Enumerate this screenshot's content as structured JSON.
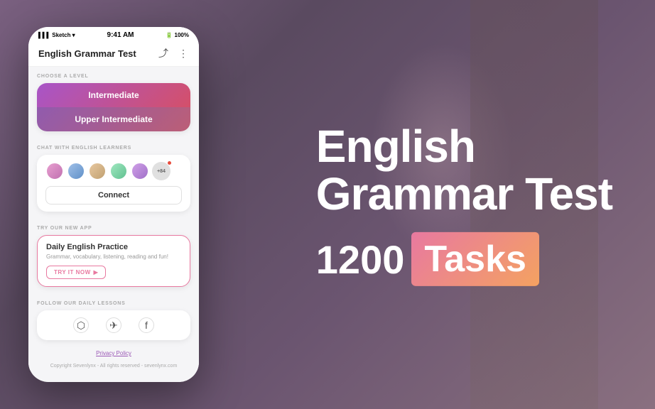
{
  "background": {
    "color": "#6b5a6e"
  },
  "phone": {
    "status_bar": {
      "carrier": "Sketch",
      "signal": "▌▌▌",
      "wifi": "▾",
      "time": "9:41 AM",
      "battery": "100%"
    },
    "header": {
      "title": "English Grammar Test",
      "share_icon": "share",
      "menu_icon": "more"
    },
    "choose_level": {
      "label": "CHOOSE A LEVEL",
      "buttons": [
        {
          "text": "Intermediate",
          "active": true
        },
        {
          "text": "Upper Intermediate",
          "active": false
        }
      ]
    },
    "chat_section": {
      "label": "CHAT WITH ENGLISH LEARNERS",
      "count_label": "+84",
      "connect_label": "Connect"
    },
    "new_app_section": {
      "label": "TRY OUR NEW APP",
      "title": "Daily English Practice",
      "subtitle": "Grammar, vocabulary, listening, reading and fun!",
      "cta": "TRY IT NOW"
    },
    "social_section": {
      "label": "FOLLOW OUR DAILY LESSONS",
      "icons": [
        "instagram",
        "telegram",
        "facebook"
      ]
    },
    "footer": {
      "privacy_label": "Privacy Policy",
      "copyright": "Copyright Sevenlynx - All rights reserved - sevenlynx.com"
    }
  },
  "right_panel": {
    "title_line1": "English",
    "title_line2": "Grammar Test",
    "count": "1200",
    "tasks_label": "Tasks"
  }
}
